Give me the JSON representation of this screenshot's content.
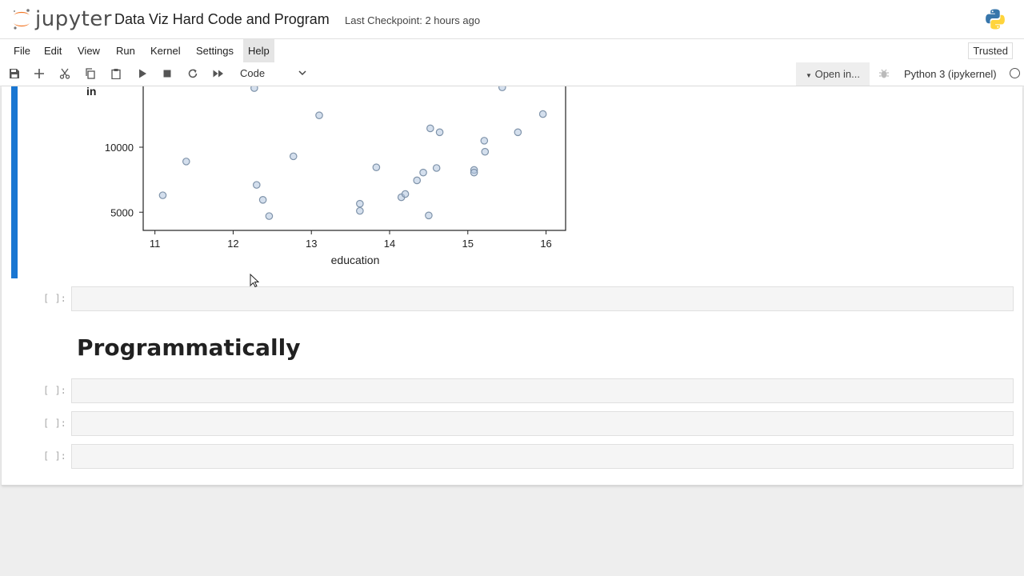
{
  "header": {
    "logo_text": "jupyter",
    "notebook_title": "Data Viz Hard Code and Program",
    "checkpoint": "Last Checkpoint: 2 hours ago"
  },
  "menu": {
    "items": [
      "File",
      "Edit",
      "View",
      "Run",
      "Kernel",
      "Settings",
      "Help"
    ],
    "active": "Help",
    "trusted": "Trusted"
  },
  "toolbar": {
    "cell_type": "Code",
    "open_in": "Open in...",
    "kernel": "Python 3 (ipykernel)"
  },
  "cells": {
    "empty_prompt": "[ ]:",
    "markdown_heading": "Programmatically"
  },
  "chart_data": {
    "type": "scatter",
    "xlabel": "education",
    "ylabel_fragment": "in",
    "xticks": [
      11,
      12,
      13,
      14,
      15,
      16
    ],
    "yticks": [
      5000,
      10000
    ],
    "xlim": [
      10.85,
      16.25
    ],
    "ylim": [
      3600,
      14800
    ],
    "marker_color": "#b0c4de",
    "points": [
      [
        11.1,
        6300
      ],
      [
        11.4,
        8900
      ],
      [
        12.27,
        14550
      ],
      [
        12.3,
        7100
      ],
      [
        12.38,
        5950
      ],
      [
        12.46,
        4700
      ],
      [
        12.77,
        9300
      ],
      [
        13.1,
        12450
      ],
      [
        13.62,
        5650
      ],
      [
        13.62,
        5100
      ],
      [
        13.83,
        8450
      ],
      [
        14.15,
        6150
      ],
      [
        14.2,
        6400
      ],
      [
        14.35,
        7450
      ],
      [
        14.43,
        8050
      ],
      [
        14.5,
        4750
      ],
      [
        14.52,
        11450
      ],
      [
        14.6,
        8400
      ],
      [
        14.64,
        11150
      ],
      [
        15.08,
        8250
      ],
      [
        15.08,
        8050
      ],
      [
        15.21,
        10500
      ],
      [
        15.22,
        9650
      ],
      [
        15.44,
        14600
      ],
      [
        15.64,
        11150
      ],
      [
        15.96,
        12550
      ]
    ]
  }
}
